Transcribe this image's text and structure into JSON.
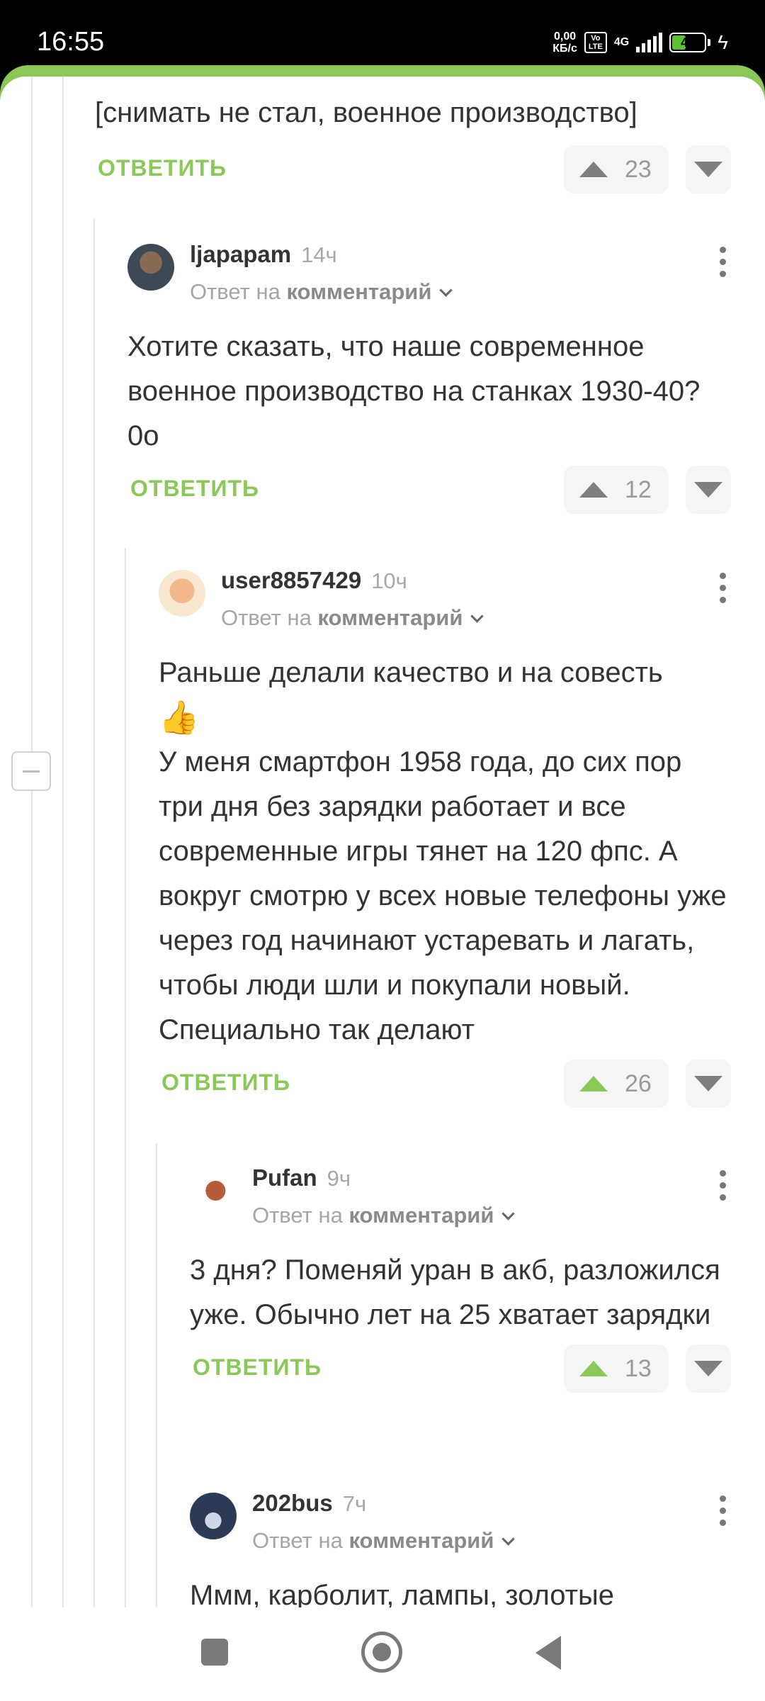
{
  "status_bar": {
    "time": "16:55",
    "speed_value": "0,00",
    "speed_unit": "КБ/с",
    "volte_top": "Vo",
    "volte_bottom": "LTE",
    "network": "4G",
    "battery": "43"
  },
  "thread": {
    "top_comment": {
      "text": "[снимать не стал, военное производство]",
      "reply_label": "ОТВЕТИТЬ",
      "score": "23"
    },
    "comments": [
      {
        "username": "ljapapam",
        "time": "14ч",
        "reply_prefix": "Ответ на",
        "reply_target": "комментарий",
        "text": "Хотите сказать, что наше современное военное производство на станках 1930-40? 0о",
        "reply_label": "ОТВЕТИТЬ",
        "score": "12"
      },
      {
        "username": "user8857429",
        "time": "10ч",
        "reply_prefix": "Ответ на",
        "reply_target": "комментарий",
        "text_line1": "Раньше делали качество и на совесть",
        "emoji": "👍",
        "text_line2": "У меня смартфон 1958 года, до сих пор три дня без зарядки работает и все современные игры тянет на 120 фпс. А вокруг смотрю у всех новые телефоны уже через год начинают устаревать и лагать, чтобы люди шли и покупали новый. Специально так делают",
        "reply_label": "ОТВЕТИТЬ",
        "score": "26"
      },
      {
        "username": "Pufan",
        "time": "9ч",
        "reply_prefix": "Ответ на",
        "reply_target": "комментарий",
        "text": "3 дня? Поменяй уран в акб, разложился уже. Обычно лет на 25 хватает зарядки",
        "reply_label": "ОТВЕТИТЬ",
        "score": "13"
      },
      {
        "username": "202bus",
        "time": "7ч",
        "reply_prefix": "Ответ на",
        "reply_target": "комментарий",
        "text": "Ммм, карболит, лампы, золотые"
      }
    ]
  },
  "colors": {
    "accent_green": "#8ac858",
    "text": "#333333",
    "muted": "#a5a5a5"
  }
}
